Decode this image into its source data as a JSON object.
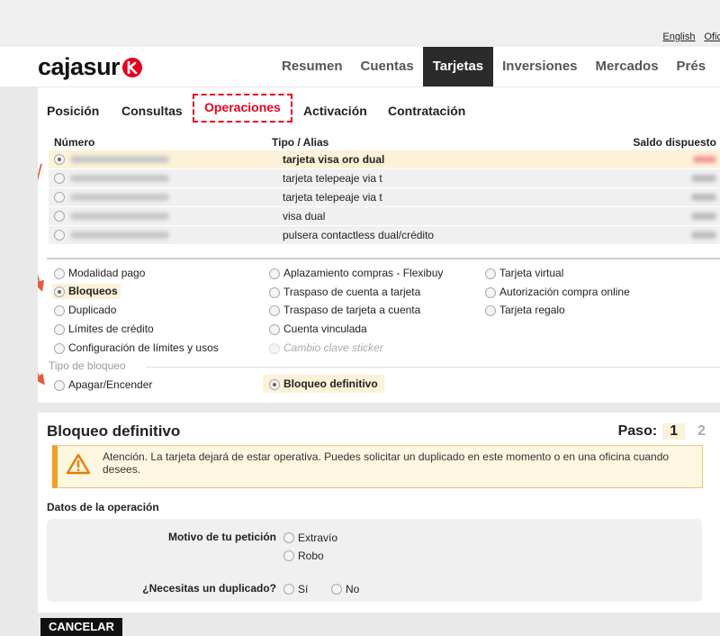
{
  "top_links": [
    "English",
    "Ofic"
  ],
  "brand": {
    "name": "cajasur",
    "accent": "#e8001c"
  },
  "main_nav": [
    "Resumen",
    "Cuentas",
    "Tarjetas",
    "Inversiones",
    "Mercados",
    "Prés"
  ],
  "main_nav_active": "Tarjetas",
  "sub_nav": [
    "Posición",
    "Consultas",
    "Operaciones",
    "Activación",
    "Contratación"
  ],
  "sub_nav_active": "Operaciones",
  "table": {
    "headers": {
      "numero": "Número",
      "tipo": "Tipo / Alias",
      "saldo": "Saldo dispuesto"
    },
    "rows": [
      {
        "alias": "tarjeta visa oro dual",
        "selected": true
      },
      {
        "alias": "tarjeta telepeaje via t",
        "selected": false
      },
      {
        "alias": "tarjeta telepeaje via t",
        "selected": false
      },
      {
        "alias": "visa dual",
        "selected": false
      },
      {
        "alias": "pulsera contactless dual/crédito",
        "selected": false
      }
    ]
  },
  "operations": {
    "col1": [
      "Modalidad pago",
      "Bloqueos",
      "Duplicado",
      "Límites de crédito",
      "Configuración de límites y usos"
    ],
    "col2": [
      "Aplazamiento compras - Flexibuy",
      "Traspaso de cuenta a tarjeta",
      "Traspaso de tarjeta a cuenta",
      "Cuenta vinculada",
      "Cambio clave sticker"
    ],
    "col3": [
      "Tarjeta virtual",
      "Autorización compra online",
      "Tarjeta regalo"
    ],
    "selected": "Bloqueos"
  },
  "block_type": {
    "legend": "Tipo de bloqueo",
    "options": [
      "Apagar/Encender",
      "Bloqueo definitivo"
    ],
    "selected": "Bloqueo definitivo"
  },
  "section": {
    "title": "Bloqueo definitivo",
    "paso_label": "Paso:",
    "step_current": "1",
    "step_next": "2",
    "warning": "Atención. La tarjeta dejará de estar operativa. Puedes solicitar un duplicado en este momento o en una oficina cuando desees.",
    "data_title": "Datos de la operación",
    "motivo_label": "Motivo de tu petición",
    "motivo_options": [
      "Extravío",
      "Robo"
    ],
    "duplicado_label": "¿Necesitas un duplicado?",
    "duplicado_options": [
      "Sí",
      "No"
    ]
  },
  "cancel_label": "CANCELAR"
}
